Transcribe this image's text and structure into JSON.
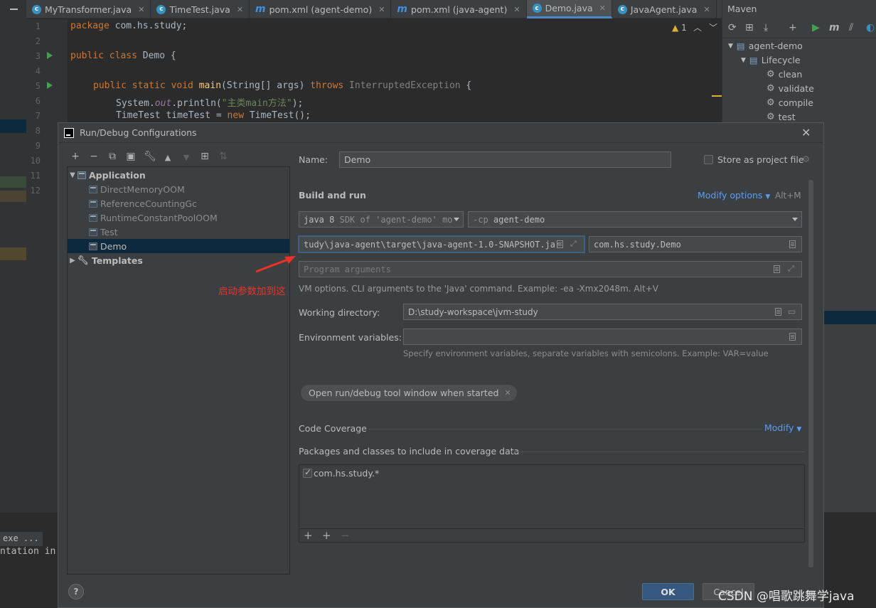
{
  "tabs": [
    {
      "label": "MyTransformer.java",
      "icon": "class-icon"
    },
    {
      "label": "TimeTest.java",
      "icon": "class-icon"
    },
    {
      "label": "pom.xml (agent-demo)",
      "icon": "maven-icon"
    },
    {
      "label": "pom.xml (java-agent)",
      "icon": "maven-icon"
    },
    {
      "label": "Demo.java",
      "icon": "class-icon",
      "active": true
    },
    {
      "label": "JavaAgent.java",
      "icon": "class-icon"
    }
  ],
  "editor": {
    "line_numbers": [
      "1",
      "2",
      "3",
      "4",
      "5",
      "6",
      "7",
      "8",
      "9",
      "10",
      "11",
      "12"
    ],
    "warnings": "1",
    "code": {
      "l1_kw": "package",
      "l1_rest": " com.hs.study;",
      "l3_kw": "public class",
      "l3_rest": " Demo {",
      "l5_kw": "public static void",
      "l5_fn": "main",
      "l5_mid": "(String[] args) ",
      "l5_kw2": "throws",
      "l5_ex": " InterruptedException",
      "l5_end": " {",
      "l6_a": "System.",
      "l6_it": "out",
      "l6_b": ".println(",
      "l6_str": "\"主类main方法\"",
      "l6_c": ");",
      "l7_a": "TimeTest timeTest = ",
      "l7_kw": "new",
      "l7_b": " TimeTest();"
    }
  },
  "bottom_panel": {
    "tab_label": "exe ...",
    "line": "ntation in"
  },
  "maven": {
    "title": "Maven",
    "project": "agent-demo",
    "lifecycle": "Lifecycle",
    "goals": [
      "clean",
      "validate",
      "compile",
      "test"
    ]
  },
  "dialog": {
    "title": "Run/Debug Configurations",
    "tree": {
      "root": "Application",
      "children": [
        "DirectMemoryOOM",
        "ReferenceCountingGc",
        "RuntimeConstantPoolOOM",
        "Test",
        "Demo"
      ],
      "selected": "Demo",
      "templates": "Templates"
    },
    "name_label": "Name:",
    "name_value": "Demo",
    "store_label": "Store as project file",
    "build_run_title": "Build and run",
    "modify_options": "Modify options",
    "modify_shortcut": "Alt+M",
    "jdk_value_a": "java 8",
    "jdk_value_b": "SDK of 'agent-demo' mo",
    "cp_flag": "-cp",
    "cp_value": "agent-demo",
    "vm_options_value": "tudy\\java-agent\\target\\java-agent-1.0-SNAPSHOT.jar",
    "main_class_value": "com.hs.study.Demo",
    "program_args_placeholder": "Program arguments",
    "vm_hint": "VM options. CLI arguments to the 'Java' command. Example: -ea -Xmx2048m. Alt+V",
    "working_dir_label": "Working directory:",
    "working_dir_value": "D:\\study-workspace\\jvm-study",
    "env_label": "Environment variables:",
    "env_value": "",
    "env_hint": "Specify environment variables, separate variables with semicolons. Example: VAR=value",
    "chip_label": "Open run/debug tool window when started",
    "coverage_title": "Code Coverage",
    "coverage_modify": "Modify",
    "packages_title": "Packages and classes to include in coverage data",
    "coverage_item": "com.hs.study.*",
    "ok_label": "OK",
    "cancel_label": "Cancel",
    "help_label": "?"
  },
  "annotation": "启动参数加到这",
  "watermark": "CSDN @唱歌跳舞学java",
  "colors": {
    "accent": "#589df6",
    "ok_button": "#365880",
    "annotation": "#e8322a",
    "selection": "#0d293e"
  }
}
